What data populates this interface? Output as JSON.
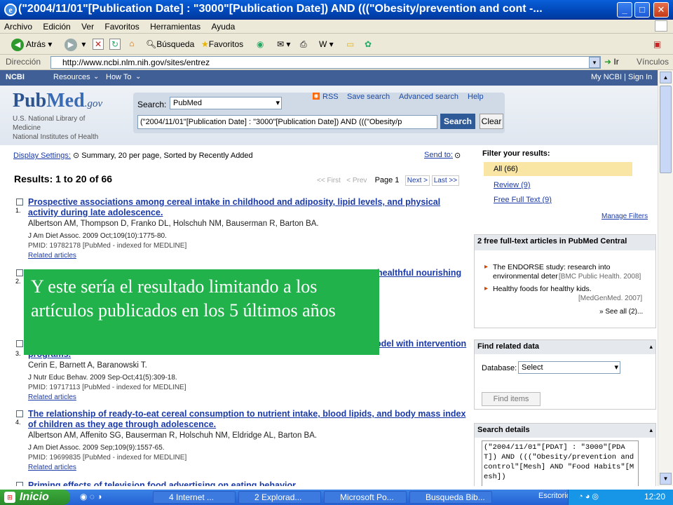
{
  "window": {
    "title": "(\"2004/11/01\"[Publication Date] : \"3000\"[Publication Date]) AND (((\"Obesity/prevention and cont -...",
    "min": "_",
    "max": "□",
    "close": "✕"
  },
  "menu": [
    "Archivo",
    "Edición",
    "Ver",
    "Favoritos",
    "Herramientas",
    "Ayuda"
  ],
  "toolbar": {
    "back": "Atrás",
    "search": "Búsqueda",
    "favorites": "Favoritos"
  },
  "address": {
    "label": "Dirección",
    "url": "http://www.ncbi.nlm.nih.gov/sites/entrez",
    "go": "Ir",
    "links": "Vínculos"
  },
  "ncbi": {
    "logo": "NCBI",
    "resources": "Resources",
    "howto": "How To",
    "myncbi": "My NCBI",
    "signin": "Sign In"
  },
  "pubmed": {
    "logo_pub": "Pub",
    "logo_med": "Med",
    "logo_gov": ".gov",
    "nlm1": "U.S. National Library of",
    "nlm2": "Medicine",
    "nlm3": "National Institutes of Health",
    "search_label": "Search:",
    "db": "PubMed",
    "query": "(\"2004/11/01\"[Publication Date] : \"3000\"[Publication Date]) AND (((\"Obesity/p",
    "search_btn": "Search",
    "clear_btn": "Clear",
    "rss": "RSS",
    "save_search": "Save search",
    "advanced": "Advanced search",
    "help": "Help"
  },
  "results": {
    "display_settings": "Display Settings:",
    "summary": "Summary, 20 per page, Sorted by Recently Added",
    "send_to": "Send to:",
    "header": "Results: 1 to 20 of 66",
    "first": "<< First",
    "prev": "< Prev",
    "page": "Page 1",
    "next": "Next >",
    "last": "Last >>",
    "items": [
      {
        "num": "1.",
        "title": "Prospective associations among cereal intake in childhood and adiposity, lipid levels, and physical activity during late adolescence.",
        "authors": "Albertson AM, Thompson D, Franko DL, Holschuh NM, Bauserman R, Barton BA.",
        "journal": "J Am Diet Assoc. 2009 Oct;109(10):1775-80.",
        "pmid": "PMID: 19782178 [PubMed - indexed for MEDLINE]",
        "related": "Related articles"
      },
      {
        "num": "2.",
        "title": "healthful nourishing"
      },
      {
        "num": "3.",
        "title": "programs.",
        "title_tail": "odel with intervention",
        "authors": "Cerin E, Barnett A, Baranowski T.",
        "journal": "J Nutr Educ Behav. 2009 Sep-Oct;41(5):309-18.",
        "pmid": "PMID: 19717113 [PubMed - indexed for MEDLINE]",
        "related": "Related articles"
      },
      {
        "num": "4.",
        "title": "The relationship of ready-to-eat cereal consumption to nutrient intake, blood lipids, and body mass index of children as they age through adolescence.",
        "authors": "Albertson AM, Affenito SG, Bauserman R, Holschuh NM, Eldridge AL, Barton BA.",
        "journal": "J Am Diet Assoc. 2009 Sep;109(9):1557-65.",
        "pmid": "PMID: 19699835 [PubMed - indexed for MEDLINE]",
        "related": "Related articles"
      },
      {
        "title": "Priming effects of television food advertising on eating behavior."
      }
    ]
  },
  "filter": {
    "title": "Filter your results:",
    "all": "All (66)",
    "review": "Review (9)",
    "free": "Free Full Text (9)",
    "manage": "Manage Filters"
  },
  "pmc": {
    "title": "2 free full-text articles in PubMed Central",
    "a1": "The ENDORSE study: research into environmental deter",
    "a1_src": "[BMC Public Health. 2008]",
    "a2": "Healthy foods for healthy kids.",
    "a2_src": "[MedGenMed. 2007]",
    "see_all": "» See all (2)..."
  },
  "related": {
    "title": "Find related data",
    "db_label": "Database:",
    "db_select": "Select",
    "find": "Find items"
  },
  "details": {
    "title": "Search details",
    "text": "(\"2004/11/01\"[PDAT] : \"3000\"[PDAT]) AND (((\"Obesity/prevention and control\"[Mesh] AND \"Food Habits\"[Mesh])"
  },
  "overlay": {
    "text": "Y este sería el resultado limitando a los artículos publicados en los 5 últimos años"
  },
  "taskbar": {
    "start": "Inicio",
    "tasks": [
      "4 Internet ...",
      "2 Explorad...",
      "Microsoft Po...",
      "Busqueda Bib..."
    ],
    "desktop": "Escritorio",
    "clock": "12:20"
  }
}
